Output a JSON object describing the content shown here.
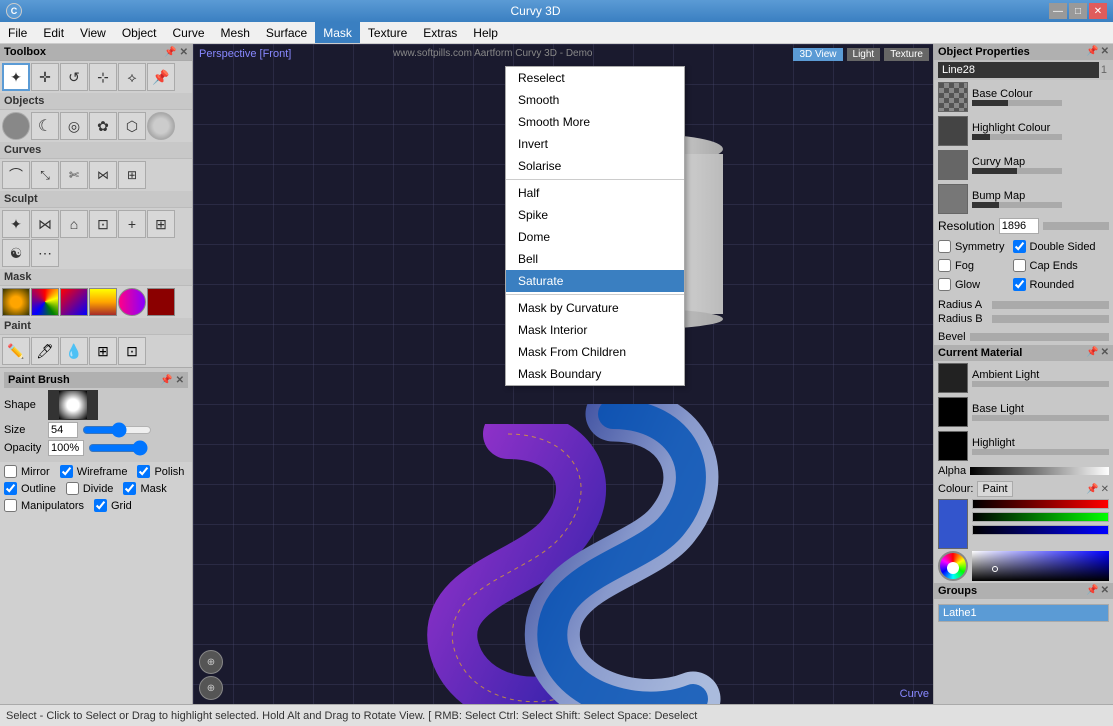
{
  "app": {
    "title": "Curvy 3D",
    "logo": "C"
  },
  "titlebar": {
    "title": "Curvy 3D",
    "min_label": "—",
    "max_label": "□",
    "close_label": "✕"
  },
  "menubar": {
    "items": [
      "File",
      "Edit",
      "View",
      "Object",
      "Curve",
      "Mesh",
      "Surface",
      "Mask",
      "Texture",
      "Extras",
      "Help"
    ]
  },
  "toolbox": {
    "title": "Toolbox",
    "sections": {
      "objects": "Objects",
      "curves": "Curves",
      "sculpt": "Sculpt",
      "mask": "Mask",
      "paint": "Paint"
    }
  },
  "paint_brush": {
    "title": "Paint Brush",
    "shape_label": "Shape",
    "size_label": "Size",
    "size_value": "54",
    "opacity_label": "Opacity",
    "opacity_value": "100%"
  },
  "bottom_checkboxes": [
    {
      "label": "Mirror",
      "checked": false
    },
    {
      "label": "Wireframe",
      "checked": true
    },
    {
      "label": "Polish",
      "checked": true
    },
    {
      "label": "Outline",
      "checked": true
    },
    {
      "label": "Divide",
      "checked": false
    },
    {
      "label": "Mask",
      "checked": true
    },
    {
      "label": "Manipulators",
      "checked": false
    },
    {
      "label": "Grid",
      "checked": true
    }
  ],
  "viewport": {
    "perspective_label": "Perspective [Front]",
    "demo_label": "www.softpills.com                         Aartform Curvy 3D - Demo",
    "view_buttons": [
      "3D View",
      "Light",
      "Texture"
    ],
    "active_view": "3D View",
    "corner_label": "Curve"
  },
  "mask_menu": {
    "active_item": "Mask",
    "items": [
      {
        "label": "Reselect",
        "separator_before": false
      },
      {
        "label": "Smooth",
        "separator_before": false
      },
      {
        "label": "Smooth More",
        "separator_before": false
      },
      {
        "label": "Invert",
        "separator_before": false
      },
      {
        "label": "Solarise",
        "separator_before": false
      },
      {
        "label": "Half",
        "separator_before": true
      },
      {
        "label": "Spike",
        "separator_before": false
      },
      {
        "label": "Dome",
        "separator_before": false
      },
      {
        "label": "Bell",
        "separator_before": false
      },
      {
        "label": "Saturate",
        "separator_before": false,
        "active": true
      },
      {
        "label": "Mask by Curvature",
        "separator_before": true
      },
      {
        "label": "Mask Interior",
        "separator_before": false
      },
      {
        "label": "Mask From Children",
        "separator_before": false
      },
      {
        "label": "Mask Boundary",
        "separator_before": false
      }
    ]
  },
  "object_properties": {
    "title": "Object Properties",
    "object_name": "Line28",
    "object_number": "1",
    "textures": [
      {
        "label": "Base Colour",
        "thumb_type": "checkerboard"
      },
      {
        "label": "Highlight Colour",
        "thumb_type": "dark"
      },
      {
        "label": "Curvy Map",
        "thumb_type": "grey"
      },
      {
        "label": "Bump Map",
        "thumb_type": "grey"
      }
    ],
    "resolution_label": "Resolution",
    "resolution_value": "1896",
    "checkboxes": [
      {
        "label": "Symmetry",
        "checked": false,
        "col": 1
      },
      {
        "label": "Double Sided",
        "checked": true,
        "col": 2
      },
      {
        "label": "Fog",
        "checked": false,
        "col": 1
      },
      {
        "label": "Cap Ends",
        "checked": false,
        "col": 2
      },
      {
        "label": "Glow",
        "checked": false,
        "col": 1
      },
      {
        "label": "Rounded",
        "checked": true,
        "col": 2
      }
    ],
    "radius_a_label": "Radius A",
    "radius_b_label": "Radius B",
    "bevel_label": "Bevel"
  },
  "current_material": {
    "title": "Current Material",
    "items": [
      {
        "label": "Ambient Light",
        "thumb": "dark"
      },
      {
        "label": "Base Light",
        "thumb": "black"
      },
      {
        "label": "Highlight",
        "thumb": "black"
      }
    ],
    "alpha_label": "Alpha"
  },
  "colour": {
    "title": "Colour:",
    "value": "Paint"
  },
  "groups": {
    "title": "Groups",
    "items": [
      {
        "label": "Lathe1",
        "active": true
      }
    ]
  },
  "statusbar": {
    "text": "Select - Click to Select or Drag to highlight selected. Hold Alt and Drag to Rotate View. [ RMB: Select  Ctrl: Select  Shift: Select  Space: Deselect"
  }
}
